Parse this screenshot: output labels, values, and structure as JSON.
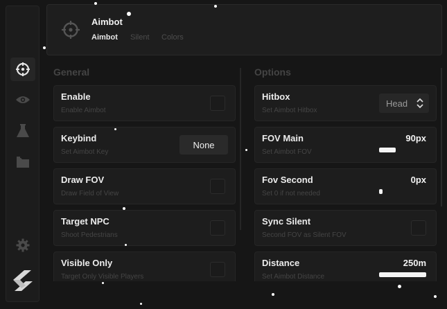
{
  "header": {
    "title": "Aimbot",
    "tabs": [
      {
        "label": "Aimbot",
        "active": true
      },
      {
        "label": "Silent",
        "active": false
      },
      {
        "label": "Colors",
        "active": false
      }
    ]
  },
  "sidebar": {
    "items": [
      {
        "icon": "crosshair-icon",
        "active": true
      },
      {
        "icon": "eye-icon",
        "active": false
      },
      {
        "icon": "flask-icon",
        "active": false
      },
      {
        "icon": "folder-icon",
        "active": false
      },
      {
        "icon": "gear-icon",
        "active": false
      }
    ]
  },
  "general": {
    "title": "General",
    "items": [
      {
        "title": "Enable",
        "subtitle": "Enable Aimbot",
        "control": "checkbox"
      },
      {
        "title": "Keybind",
        "subtitle": "Set Aimbot Key",
        "control": "key",
        "value": "None"
      },
      {
        "title": "Draw FOV",
        "subtitle": "Draw Field of View",
        "control": "checkbox"
      },
      {
        "title": "Target NPC",
        "subtitle": "Shoot Pedestrians",
        "control": "checkbox"
      },
      {
        "title": "Visible Only",
        "subtitle": "Target Only Visible Players",
        "control": "checkbox"
      }
    ]
  },
  "options": {
    "title": "Options",
    "items": [
      {
        "title": "Hitbox",
        "subtitle": "Set Aimbot Hitbox",
        "control": "select",
        "value": "Head"
      },
      {
        "title": "FOV Main",
        "subtitle": "Set Aimbot FOV",
        "control": "slider",
        "value": "90px",
        "fill": 0.35
      },
      {
        "title": "Fov Second",
        "subtitle": "Set 0 if not needed",
        "control": "slider",
        "value": "0px",
        "fill": 0.07
      },
      {
        "title": "Sync Silent",
        "subtitle": "Second FOV as Silent FOV",
        "control": "checkbox"
      },
      {
        "title": "Distance",
        "subtitle": "Set Aimbot Distance",
        "control": "slider",
        "value": "250m",
        "fill": 1.0
      }
    ]
  },
  "colors": {
    "background": "#161616",
    "panel": "#1d1d1d",
    "accent": "#ffffff",
    "muted": "#454545"
  }
}
